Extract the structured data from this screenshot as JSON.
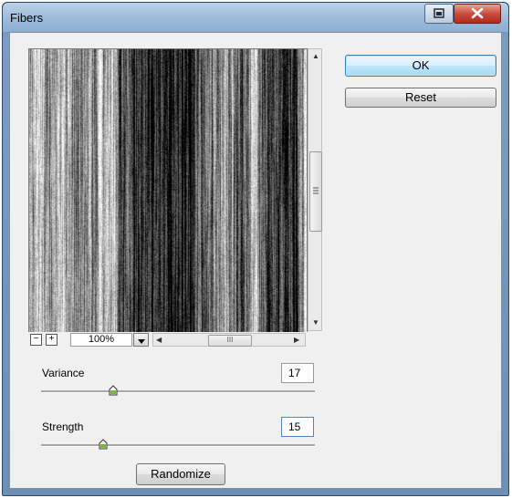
{
  "window": {
    "title": "Fibers"
  },
  "titlebar": {
    "restore_icon": "restore-icon",
    "close_icon": "close-icon"
  },
  "dialog": {
    "ok_label": "OK",
    "reset_label": "Reset",
    "randomize_label": "Randomize"
  },
  "preview": {
    "zoom": "100%",
    "zoom_out_icon": "minus-icon",
    "zoom_in_icon": "plus-icon",
    "scroll_grip": "III"
  },
  "variance": {
    "label": "Variance",
    "value": "17"
  },
  "strength": {
    "label": "Strength",
    "value": "15"
  }
}
